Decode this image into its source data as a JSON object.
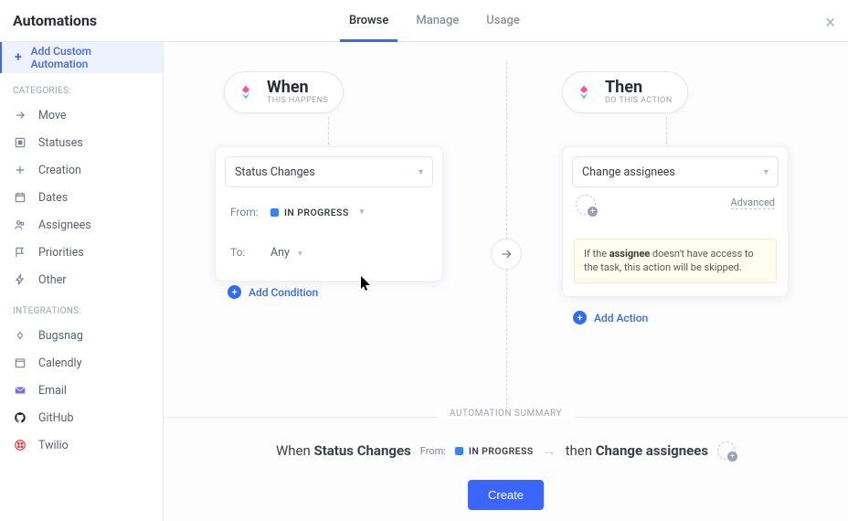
{
  "header": {
    "title": "Automations",
    "tabs": [
      "Browse",
      "Manage",
      "Usage"
    ],
    "active_tab": 0
  },
  "sidebar": {
    "add_label": "Add Custom Automation",
    "section_categories": "CATEGORIES:",
    "categories": [
      {
        "label": "Move",
        "icon": "move"
      },
      {
        "label": "Statuses",
        "icon": "statuses"
      },
      {
        "label": "Creation",
        "icon": "creation"
      },
      {
        "label": "Dates",
        "icon": "dates"
      },
      {
        "label": "Assignees",
        "icon": "assignees"
      },
      {
        "label": "Priorities",
        "icon": "priorities"
      },
      {
        "label": "Other",
        "icon": "other"
      }
    ],
    "section_integrations": "INTEGRATIONS:",
    "integrations": [
      {
        "label": "Bugsnag",
        "icon": "bugsnag"
      },
      {
        "label": "Calendly",
        "icon": "calendly"
      },
      {
        "label": "Email",
        "icon": "email"
      },
      {
        "label": "GitHub",
        "icon": "github"
      },
      {
        "label": "Twilio",
        "icon": "twilio"
      }
    ]
  },
  "when": {
    "heading": "When",
    "subheading": "THIS HAPPENS",
    "trigger_select": "Status Changes",
    "from_label": "From:",
    "from_value": "IN PROGRESS",
    "to_label": "To:",
    "to_value": "Any",
    "add_condition": "Add Condition"
  },
  "then": {
    "heading": "Then",
    "subheading": "DO THIS ACTION",
    "action_select": "Change assignees",
    "advanced": "Advanced",
    "note_prefix": "If the ",
    "note_bold": "assignee",
    "note_suffix": " doesn't have access to the task, this action will be skipped.",
    "add_action": "Add Action"
  },
  "summary": {
    "label": "AUTOMATION SUMMARY",
    "when_word": "When ",
    "trigger": "Status Changes",
    "from_label": "From:",
    "from_value": "IN PROGRESS",
    "then_word": "then ",
    "action": "Change assignees",
    "create": "Create"
  },
  "colors": {
    "accent": "#3a66ff",
    "status_blue": "#3b82f6"
  }
}
